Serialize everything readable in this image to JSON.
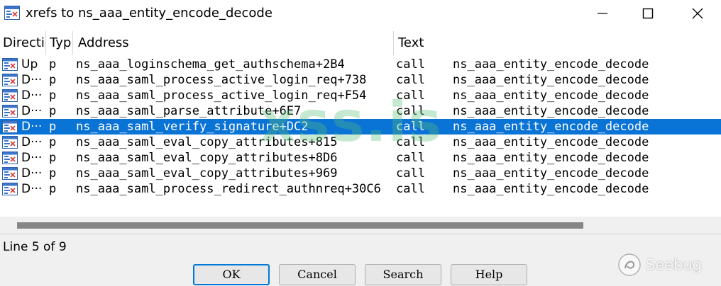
{
  "window": {
    "title": "xrefs to ns_aaa_entity_encode_decode",
    "icons": {
      "app": "xref-window-icon",
      "minimize": "minimize-icon",
      "maximize": "maximize-icon",
      "close": "close-icon"
    }
  },
  "columns": [
    "Directi",
    "Typ",
    "Address",
    "Text"
  ],
  "rows": [
    {
      "direction": "Up",
      "type": "p",
      "address": "ns_aaa_loginschema_get_authschema+2B4",
      "mnemonic": "call",
      "operand": "ns_aaa_entity_encode_decode",
      "selected": false
    },
    {
      "direction": "D···",
      "type": "p",
      "address": "ns_aaa_saml_process_active_login_req+738",
      "mnemonic": "call",
      "operand": "ns_aaa_entity_encode_decode",
      "selected": false
    },
    {
      "direction": "D···",
      "type": "p",
      "address": "ns_aaa_saml_process_active_login_req+F54",
      "mnemonic": "call",
      "operand": "ns_aaa_entity_encode_decode",
      "selected": false
    },
    {
      "direction": "D···",
      "type": "p",
      "address": "ns_aaa_saml_parse_attribute+6E7",
      "mnemonic": "call",
      "operand": "ns_aaa_entity_encode_decode",
      "selected": false
    },
    {
      "direction": "D···",
      "type": "p",
      "address": "ns_aaa_saml_verify_signature+DC2",
      "mnemonic": "call",
      "operand": "ns_aaa_entity_encode_decode",
      "selected": true
    },
    {
      "direction": "D···",
      "type": "p",
      "address": "ns_aaa_saml_eval_copy_attributes+815",
      "mnemonic": "call",
      "operand": "ns_aaa_entity_encode_decode",
      "selected": false
    },
    {
      "direction": "D···",
      "type": "p",
      "address": "ns_aaa_saml_eval_copy_attributes+8D6",
      "mnemonic": "call",
      "operand": "ns_aaa_entity_encode_decode",
      "selected": false
    },
    {
      "direction": "D···",
      "type": "p",
      "address": "ns_aaa_saml_eval_copy_attributes+969",
      "mnemonic": "call",
      "operand": "ns_aaa_entity_encode_decode",
      "selected": false
    },
    {
      "direction": "D···",
      "type": "p",
      "address": "ns_aaa_saml_process_redirect_authnreq+30C6",
      "mnemonic": "call",
      "operand": "ns_aaa_entity_encode_decode",
      "selected": false
    }
  ],
  "status": "Line 5 of 9",
  "buttons": {
    "ok": "OK",
    "cancel": "Cancel",
    "search": "Search",
    "help": "Help"
  },
  "watermark": "xss.is",
  "logo": "Seebug",
  "colors": {
    "selection": "#0a73d6",
    "selection_text": "#ffffff",
    "default_button_border": "#0078d7"
  }
}
